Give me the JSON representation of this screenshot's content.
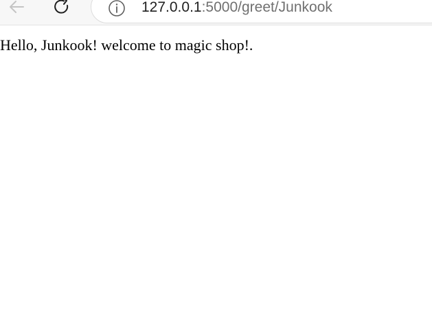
{
  "browser": {
    "address_bar": {
      "host": "127.0.0.1",
      "path": ":5000/greet/Junkook"
    },
    "icons": {
      "back": "arrow-left-icon",
      "reload": "reload-icon",
      "site_info": "info-circle-icon"
    }
  },
  "page": {
    "greeting": "Hello, Junkook! welcome to magic shop!."
  }
}
